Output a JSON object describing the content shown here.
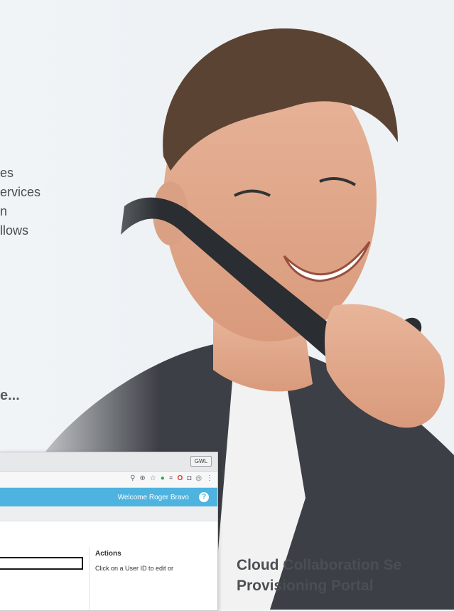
{
  "marketing": {
    "lines": [
      "es",
      "ervices",
      "n",
      "llows"
    ],
    "tagline": "e..."
  },
  "browser": {
    "badge": "GWL",
    "welcome_text": "Welcome Roger Bravo",
    "help_glyph": "?",
    "actions_title": "Actions",
    "actions_hint": "Click on a User ID to edit or"
  },
  "portal": {
    "title_line1": "Cloud Collaboration Se",
    "title_line2": "Provisioning Portal"
  },
  "colors": {
    "accent": "#4fb3e0",
    "text": "#4b4e53"
  }
}
